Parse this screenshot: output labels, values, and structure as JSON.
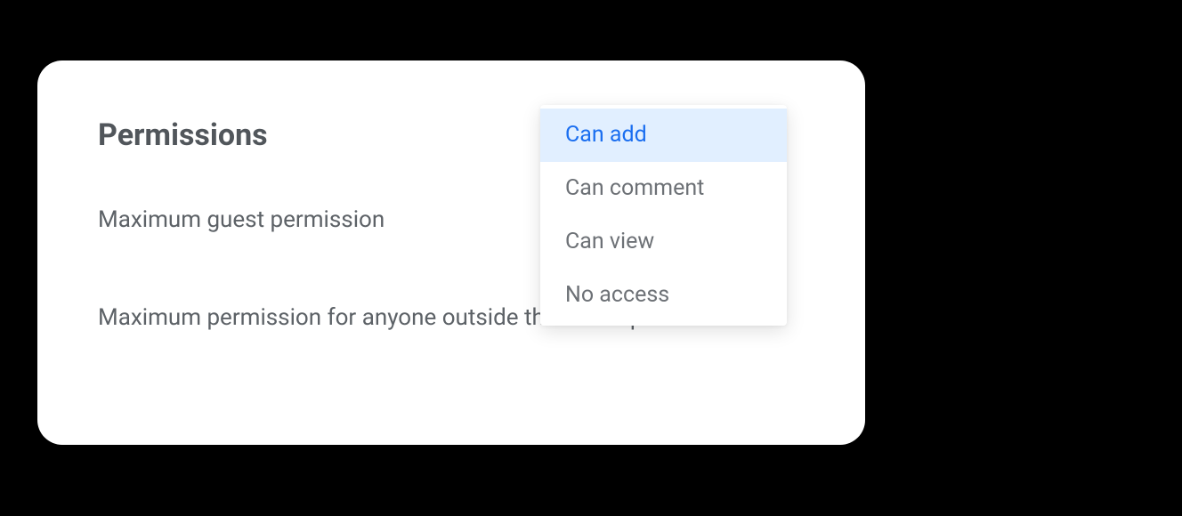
{
  "section": {
    "title": "Permissions"
  },
  "settings": {
    "guest_permission_label": "Maximum guest permission",
    "outside_permission_label": "Maximum permission for anyone outside this workspace"
  },
  "dropdown": {
    "options": [
      {
        "label": "Can add",
        "selected": true
      },
      {
        "label": "Can comment",
        "selected": false
      },
      {
        "label": "Can view",
        "selected": false
      },
      {
        "label": "No access",
        "selected": false
      }
    ]
  }
}
